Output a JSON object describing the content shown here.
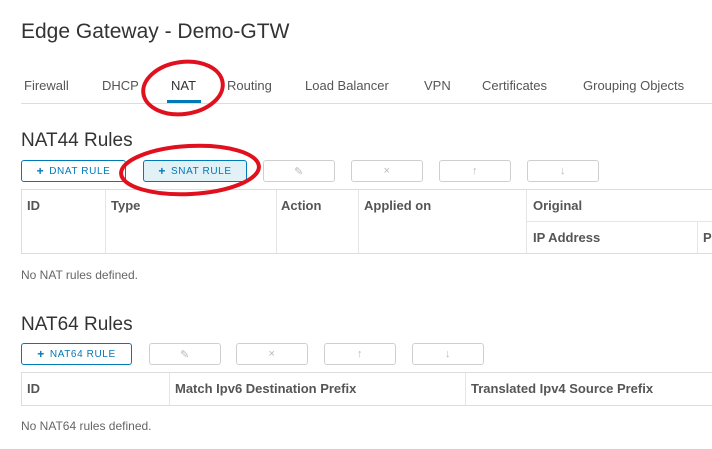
{
  "page": {
    "title": "Edge Gateway - Demo-GTW"
  },
  "tabs": [
    {
      "label": "Firewall"
    },
    {
      "label": "DHCP"
    },
    {
      "label": "NAT"
    },
    {
      "label": "Routing"
    },
    {
      "label": "Load Balancer"
    },
    {
      "label": "VPN"
    },
    {
      "label": "Certificates"
    },
    {
      "label": "Grouping Objects"
    }
  ],
  "active_tab": "NAT",
  "nat44": {
    "title": "NAT44 Rules",
    "buttons": {
      "dnat": "DNAT RULE",
      "snat": "SNAT RULE"
    },
    "columns": {
      "id": "ID",
      "type": "Type",
      "action": "Action",
      "applied_on": "Applied on",
      "original": "Original",
      "ip_address": "IP Address",
      "port_partial": "Po"
    },
    "empty_message": "No NAT rules defined."
  },
  "nat64": {
    "title": "NAT64 Rules",
    "buttons": {
      "add": "NAT64 RULE"
    },
    "columns": {
      "id": "ID",
      "match": "Match Ipv6 Destination Prefix",
      "translated": "Translated Ipv4 Source Prefix"
    },
    "empty_message": "No NAT64 rules defined."
  },
  "icons": {
    "plus": "+",
    "edit": "✎",
    "delete": "×",
    "up": "↑",
    "down": "↓"
  },
  "colors": {
    "accent": "#0079b8",
    "annotation": "#e0101e",
    "selected_bg": "#e1f1f6"
  }
}
